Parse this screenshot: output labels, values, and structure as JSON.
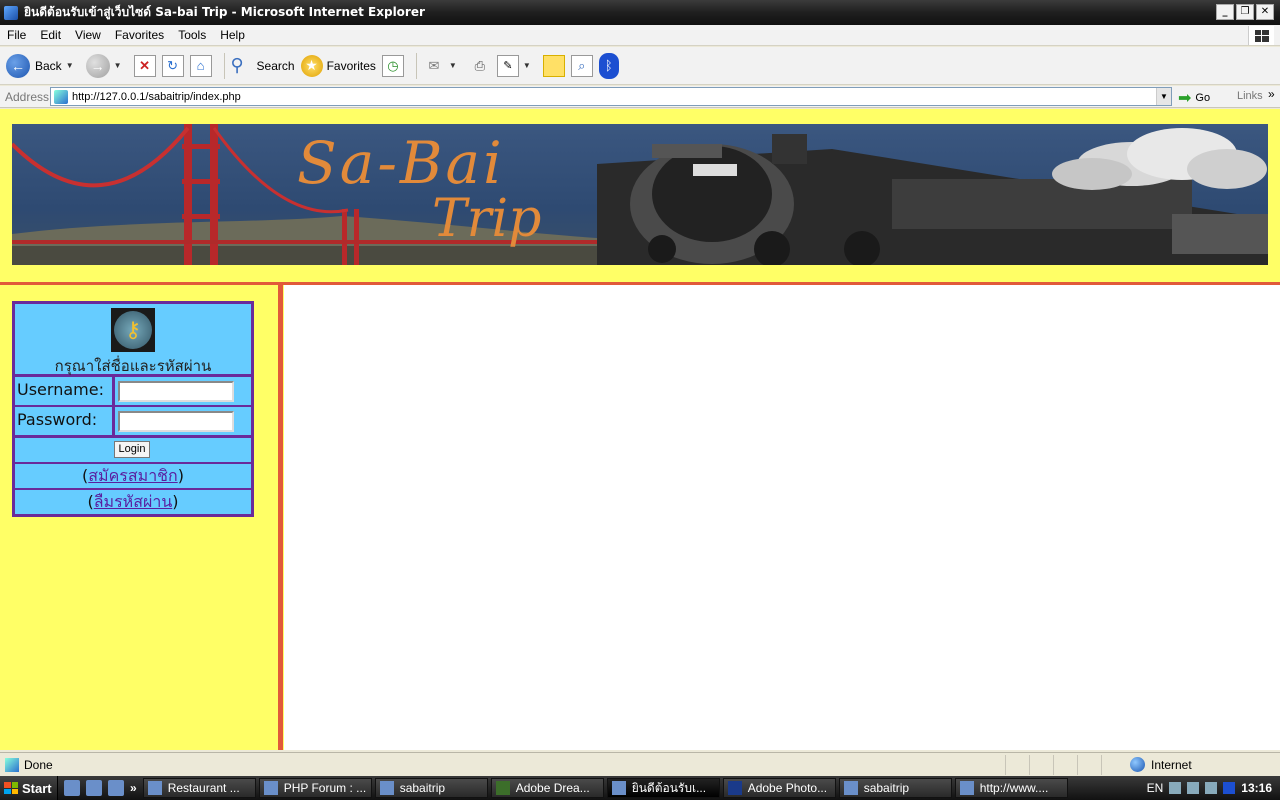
{
  "window": {
    "title": "ยินดีต้อนรับเข้าสู่เว็บไซด์ Sa-bai Trip - Microsoft Internet Explorer",
    "buttons": {
      "minimize": "_",
      "restore": "❐",
      "close": "✕"
    }
  },
  "menu": [
    "File",
    "Edit",
    "View",
    "Favorites",
    "Tools",
    "Help"
  ],
  "toolbar": {
    "back_label": "Back",
    "search_label": "Search",
    "favorites_label": "Favorites"
  },
  "address": {
    "label": "Address",
    "url": "http://127.0.0.1/sabaitrip/index.php",
    "go_label": "Go",
    "links_label": "Links"
  },
  "banner": {
    "line1": "Sa-Bai",
    "line2": "Trip"
  },
  "login": {
    "prompt": "กรุณาใส่ชื่อและรหัสผ่าน",
    "username_label": "Username:",
    "password_label": "Password:",
    "login_button": "Login",
    "register_link": "สมัครสมาชิก",
    "forgot_link": "ลืมรหัสผ่าน"
  },
  "status": {
    "text": "Done",
    "zone": "Internet"
  },
  "taskbar": {
    "start_label": "Start",
    "tasks": [
      {
        "label": "Restaurant ..."
      },
      {
        "label": "PHP Forum : ..."
      },
      {
        "label": "sabaitrip"
      },
      {
        "label": "Adobe Drea..."
      },
      {
        "label": "ยินดีต้อนรับเ..."
      },
      {
        "label": "Adobe Photo..."
      },
      {
        "label": "sabaitrip"
      },
      {
        "label": "http://www...."
      }
    ],
    "lang": "EN",
    "clock": "13:16"
  }
}
